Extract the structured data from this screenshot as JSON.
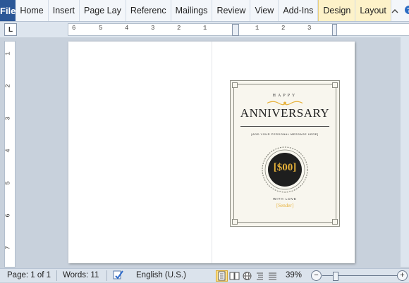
{
  "ribbon": {
    "file_label": "File",
    "tabs": [
      "Home",
      "Insert",
      "Page Lay",
      "Referenc",
      "Mailings",
      "Review",
      "View",
      "Add-Ins"
    ],
    "context_tabs": [
      "Design",
      "Layout"
    ],
    "minimize_icon": "chevron-up-icon",
    "help_icon": "help-icon"
  },
  "ruler": {
    "corner_label": "L",
    "left_numbers": [
      "6",
      "5",
      "4",
      "3",
      "2",
      "1"
    ],
    "right_numbers": [
      "1",
      "2",
      "3"
    ],
    "vertical_numbers": [
      "1",
      "2",
      "3",
      "4",
      "5",
      "6",
      "7"
    ]
  },
  "card": {
    "happy": "HAPPY",
    "title": "ANNIVERSARY",
    "message": "[ADD YOUR PERSONAL MESSAGE HERE]",
    "amount": "[$00]",
    "with_love": "WITH LOVE",
    "sender": "[Sender]",
    "accent_color": "#e6b13a"
  },
  "status": {
    "page": "Page: 1 of 1",
    "words": "Words: 11",
    "language": "English (U.S.)",
    "zoom": "39%",
    "zoom_out": "−",
    "zoom_in": "+",
    "zoom_level": 0.39
  }
}
